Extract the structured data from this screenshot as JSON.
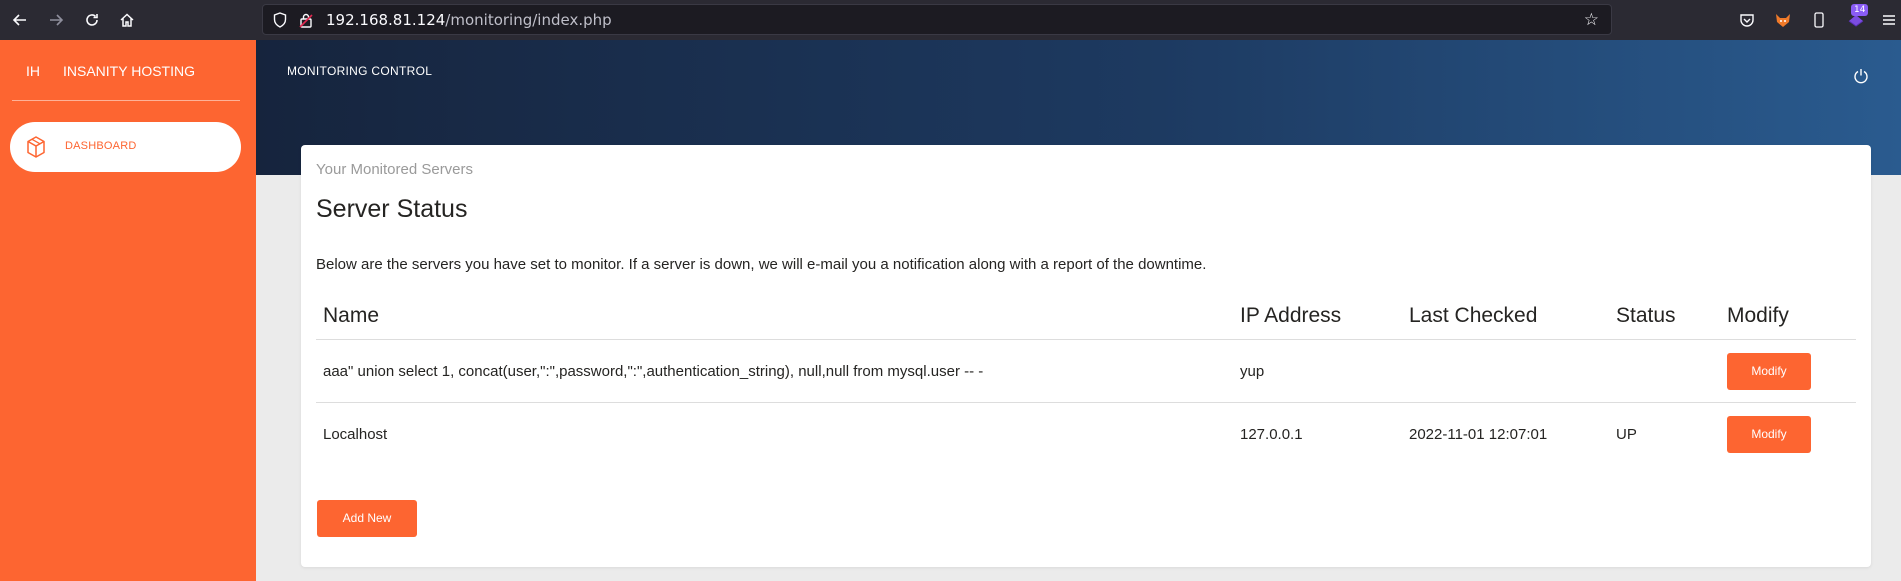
{
  "browser": {
    "url_host": "192.168.81.124",
    "url_path": "/monitoring/index.php",
    "extension_badge": "14"
  },
  "sidebar": {
    "logo_short": "IH",
    "brand_name": "INSANITY HOSTING",
    "items": [
      {
        "label": "DASHBOARD",
        "icon": "box-icon",
        "active": true
      }
    ]
  },
  "header": {
    "title": "MONITORING CONTROL"
  },
  "card": {
    "subtitle": "Your Monitored Servers",
    "title": "Server Status",
    "description": "Below are the servers you have set to monitor. If a server is down, we will e-mail you a notification along with a report of the downtime.",
    "columns": [
      "Name",
      "IP Address",
      "Last Checked",
      "Status",
      "Modify"
    ],
    "rows": [
      {
        "name": "aaa\" union select 1, concat(user,\":\",password,\":\",authentication_string), null,null from mysql.user -- -",
        "ip": "yup",
        "last_checked": "",
        "status": "",
        "modify_label": "Modify"
      },
      {
        "name": "Localhost",
        "ip": "127.0.0.1",
        "last_checked": "2022-11-01 12:07:01",
        "status": "UP",
        "modify_label": "Modify"
      }
    ],
    "add_button_label": "Add New"
  },
  "colors": {
    "accent": "#fd6531",
    "header_dark": "#16243d",
    "header_light": "#2a5b8f"
  }
}
